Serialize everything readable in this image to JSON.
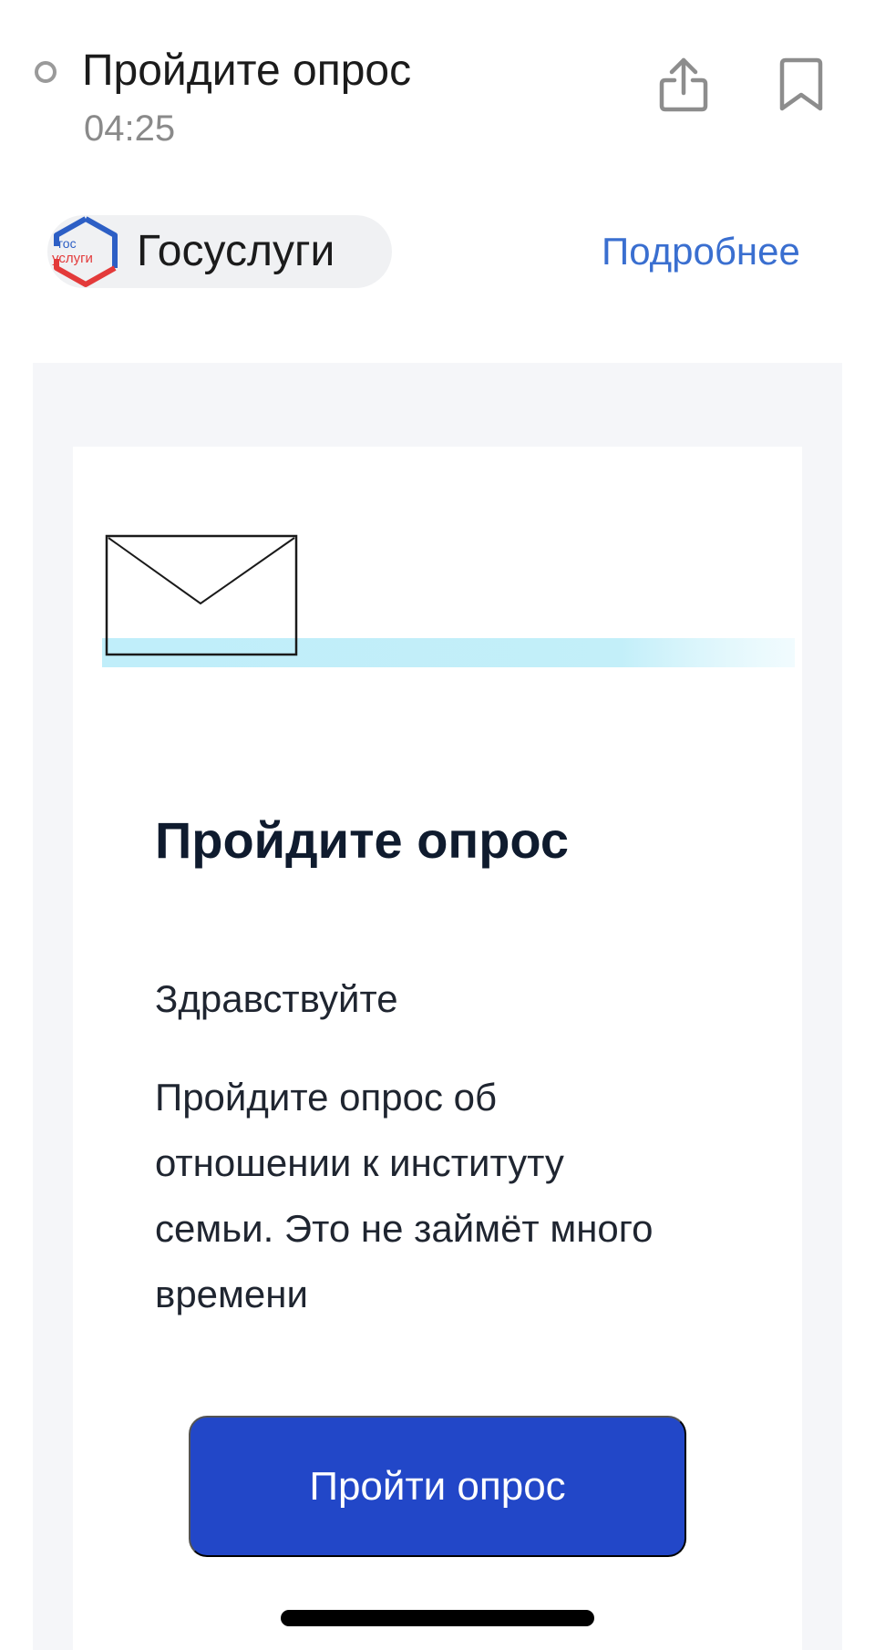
{
  "header": {
    "title": "Пройдите опрос",
    "time": "04:25",
    "share_icon": "share-upload-icon",
    "bookmark_icon": "bookmark-icon"
  },
  "sender": {
    "logo_line1": "гос",
    "logo_line2": "услуги",
    "name": "Госуслуги",
    "details_link": "Подробнее"
  },
  "email": {
    "heading": "Пройдите опрос",
    "greeting": "Здравствуйте",
    "text": "Пройдите опрос об отношении к институту семьи. Это не займёт много времени",
    "button_label": "Пройти опрос",
    "banner_icon": "envelope-icon"
  },
  "colors": {
    "accent": "#2247c8",
    "link": "#3a6fd0",
    "logo_blue": "#2d5fc5",
    "logo_red": "#e33a3a",
    "banner_stripe": "#b9ecf9"
  }
}
